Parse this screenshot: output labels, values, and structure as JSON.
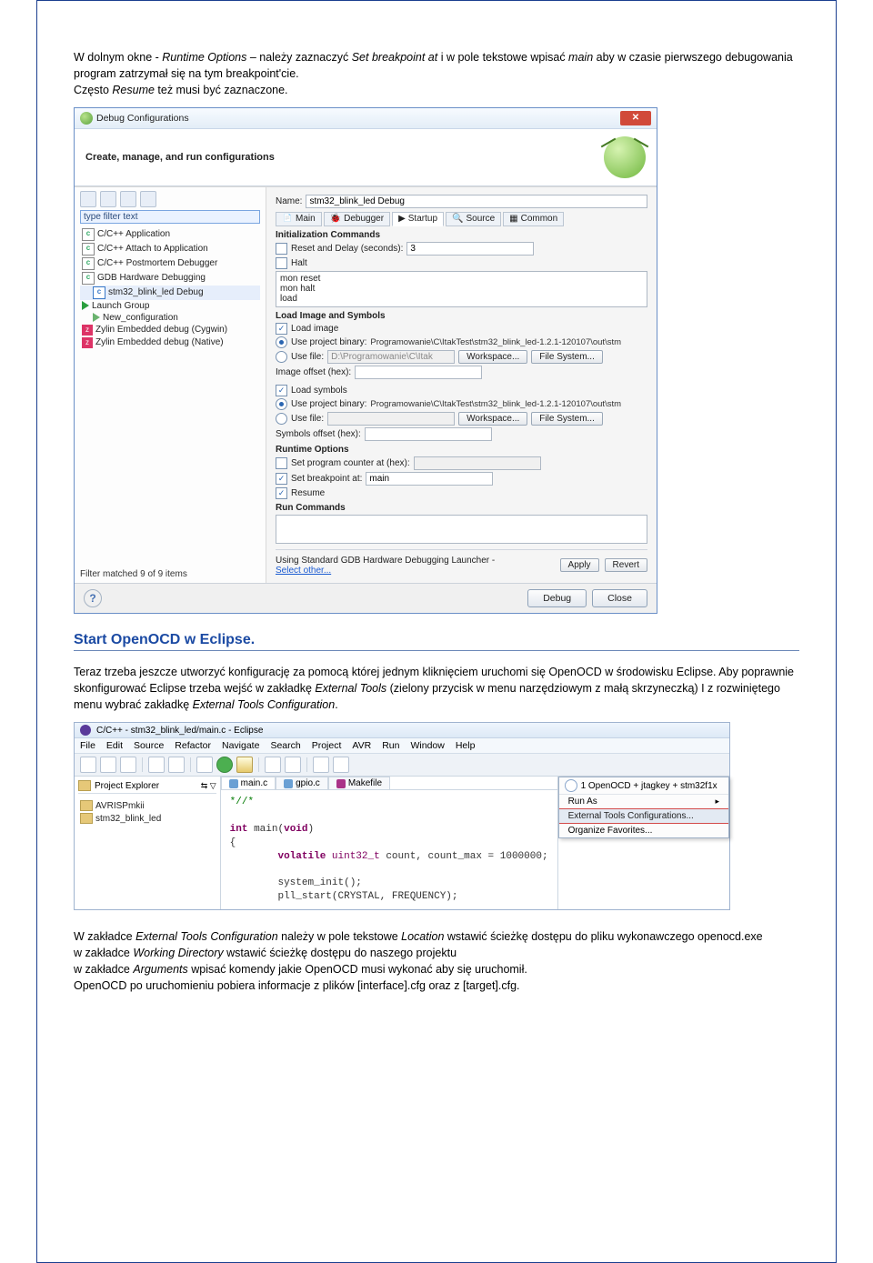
{
  "para1": {
    "t1": "W dolnym okne - ",
    "i1": "Runtime Options",
    "t2": " – należy zaznaczyć ",
    "i2": "Set breakpoint at",
    "t3": " i w pole tekstowe wpisać ",
    "i3": "main",
    "t4": " aby w czasie pierwszego debugowania program zatrzymał się na tym breakpoint'cie.",
    "line2a": "Często ",
    "line2i": "Resume",
    "line2b": " też musi być zaznaczone."
  },
  "dialog": {
    "title": "Debug Configurations",
    "subtitle": "Create, manage, and run configurations",
    "filter_placeholder": "type filter text",
    "tree": {
      "cpp_app": "C/C++ Application",
      "cpp_attach": "C/C++ Attach to Application",
      "cpp_post": "C/C++ Postmortem Debugger",
      "gdb_hw": "GDB Hardware Debugging",
      "stm32": "stm32_blink_led Debug",
      "launch_group": "Launch Group",
      "new_conf": "New_configuration",
      "zylin_c": "Zylin Embedded debug (Cygwin)",
      "zylin_n": "Zylin Embedded debug (Native)"
    },
    "filter_status": "Filter matched 9 of 9 items",
    "name_label": "Name:",
    "name_value": "stm32_blink_led Debug",
    "tabs": {
      "main": "Main",
      "debugger": "Debugger",
      "startup": "Startup",
      "source": "Source",
      "common": "Common"
    },
    "sec_init": "Initialization Commands",
    "reset_delay_label": "Reset and Delay (seconds):",
    "reset_delay_val": "3",
    "halt_label": "Halt",
    "cmds": "mon reset\nmon halt\nload",
    "sec_load": "Load Image and Symbols",
    "load_image": "Load image",
    "use_proj_bin": "Use project binary:",
    "bin_path": "Programowanie\\C\\ItakTest\\stm32_blink_led-1.2.1-120107\\out\\stm",
    "use_file": "Use file:",
    "file_path": "D:\\Programowanie\\C\\Itak",
    "workspace_btn": "Workspace...",
    "filesystem_btn": "File System...",
    "image_offset": "Image offset (hex):",
    "load_symbols": "Load symbols",
    "sym_offset": "Symbols offset (hex):",
    "sec_runtime": "Runtime Options",
    "set_pc": "Set program counter at (hex):",
    "set_bp": "Set breakpoint at:",
    "bp_val": "main",
    "resume": "Resume",
    "sec_runcmd": "Run Commands",
    "launcher_text": "Using Standard GDB Hardware Debugging Launcher -",
    "launcher_link": "Select other...",
    "apply": "Apply",
    "revert": "Revert",
    "debug_btn": "Debug",
    "close_btn": "Close"
  },
  "heading2": "Start OpenOCD w Eclipse.",
  "para2": "Teraz trzeba jeszcze utworzyć konfigurację za pomocą której jednym kliknięciem uruchomi się OpenOCD w środowisku Eclipse. Aby poprawnie skonfigurować Eclipse trzeba wejść w zakładkę  ",
  "para2_i1": "External Tools",
  "para2_2": " (zielony przycisk w menu narzędziowym z małą skrzyneczką) I z rozwiniętego menu wybrać zakładkę ",
  "para2_i2": "External Tools Configuration",
  "para2_3": ".",
  "eclipse": {
    "title": "C/C++ - stm32_blink_led/main.c - Eclipse",
    "menu": [
      "File",
      "Edit",
      "Source",
      "Refactor",
      "Navigate",
      "Search",
      "Project",
      "AVR",
      "Run",
      "Window",
      "Help"
    ],
    "proj_explorer": "Project Explorer",
    "proj1": "AVRISPmkii",
    "proj2": "stm32_blink_led",
    "ed_tabs": {
      "t1": "main.c",
      "t2": "gpio.c",
      "t3": "Makefile"
    },
    "code_cmt": "*//*",
    "code_l1": "int main(void)",
    "code_l2": "{",
    "code_l3": "        volatile uint32_t count, count_max = 1000000;",
    "code_l4": "        system_init();",
    "code_l5": "        pll_start(CRYSTAL, FREQUENCY);",
    "menu_pop": {
      "header": "1 OpenOCD + jtagkey + stm32f1x",
      "run_as": "Run As",
      "ext_tools": "External Tools Configurations...",
      "org_fav": "Organize Favorites..."
    }
  },
  "para3_1": "W zakładce ",
  "para3_i1": "External Tools Configuration ",
  "para3_2": " należy w pole tekstowe ",
  "para3_i2": "Location",
  "para3_3": " wstawić ścieżkę dostępu do pliku wykonawczego openocd.exe",
  "para3_4a": "w zakładce ",
  "para3_i3": "Working Directory",
  "para3_4b": " wstawić ścieżkę dostępu do naszego projektu",
  "para3_5a": "w zakładce ",
  "para3_i4": "Arguments",
  "para3_5b": " wpisać komendy jakie OpenOCD musi wykonać aby się uruchomił.",
  "para3_6": "OpenOCD po uruchomieniu pobiera informacje z plików [interface].cfg oraz z [target].cfg."
}
